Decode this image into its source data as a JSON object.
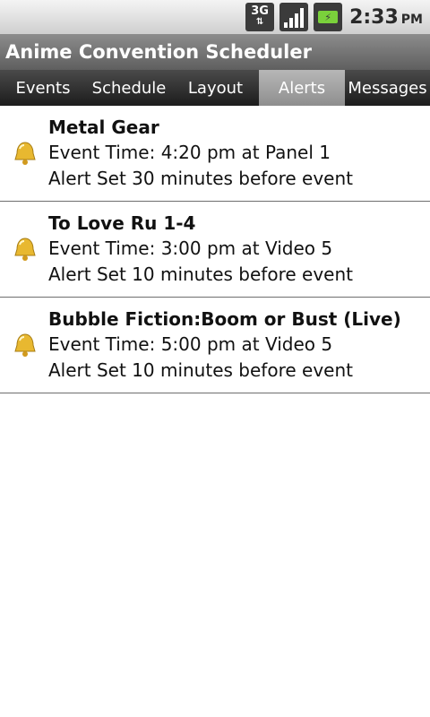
{
  "status_bar": {
    "network_label": "3G",
    "battery_icon": "battery-charging-icon",
    "signal_icon": "signal-strength-icon",
    "time": "2:33",
    "ampm": "PM"
  },
  "app": {
    "title": "Anime Convention Scheduler"
  },
  "tabs": [
    {
      "label": "Events",
      "active": false
    },
    {
      "label": "Schedule",
      "active": false
    },
    {
      "label": "Layout",
      "active": false
    },
    {
      "label": "Alerts",
      "active": true
    },
    {
      "label": "Messages",
      "active": false
    }
  ],
  "alerts": [
    {
      "icon": "bell-icon",
      "title": "Metal Gear",
      "event_time": "Event Time: 4:20 pm at Panel 1",
      "alert_set": "Alert Set 30 minutes before event"
    },
    {
      "icon": "bell-icon",
      "title": "To Love Ru 1-4",
      "event_time": "Event Time: 3:00 pm at Video 5",
      "alert_set": "Alert Set 10 minutes before event"
    },
    {
      "icon": "bell-icon",
      "title": "Bubble Fiction:Boom or Bust (Live)",
      "event_time": "Event Time: 5:00 pm at Video 5",
      "alert_set": "Alert Set 10 minutes before event"
    }
  ],
  "colors": {
    "bell_gold": "#e8b830",
    "battery_green": "#7ad13b",
    "active_tab": "#a3a3a3"
  }
}
